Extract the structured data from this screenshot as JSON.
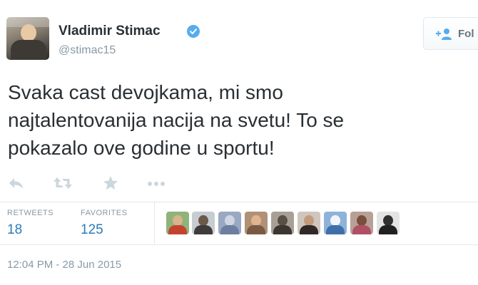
{
  "author": {
    "name": "Vladimir Stimac",
    "handle": "@stimac15",
    "verified": true
  },
  "follow_button": {
    "label": "Follow",
    "visible_label": "Fol"
  },
  "tweet": {
    "lines": [
      "Svaka cast devojkama, mi smo",
      "najtalentovanija nacija na svetu! To se",
      "pokazalo ove godine u sportu!"
    ]
  },
  "actions": [
    {
      "name": "reply",
      "icon": "reply-icon"
    },
    {
      "name": "retweet",
      "icon": "retweet-icon"
    },
    {
      "name": "favorite",
      "icon": "star-icon"
    },
    {
      "name": "more",
      "icon": "more-icon"
    }
  ],
  "stats": {
    "retweets_label": "RETWEETS",
    "retweets_count": "18",
    "favorites_label": "FAVORITES",
    "favorites_count": "125"
  },
  "favoriter_avatars": 9,
  "timestamp": "12:04 PM - 28 Jun 2015",
  "colors": {
    "accent": "#2b7bb9",
    "verified": "#55acee",
    "muted": "#8899a6",
    "text": "#292f33",
    "border": "#e1e8ed"
  }
}
